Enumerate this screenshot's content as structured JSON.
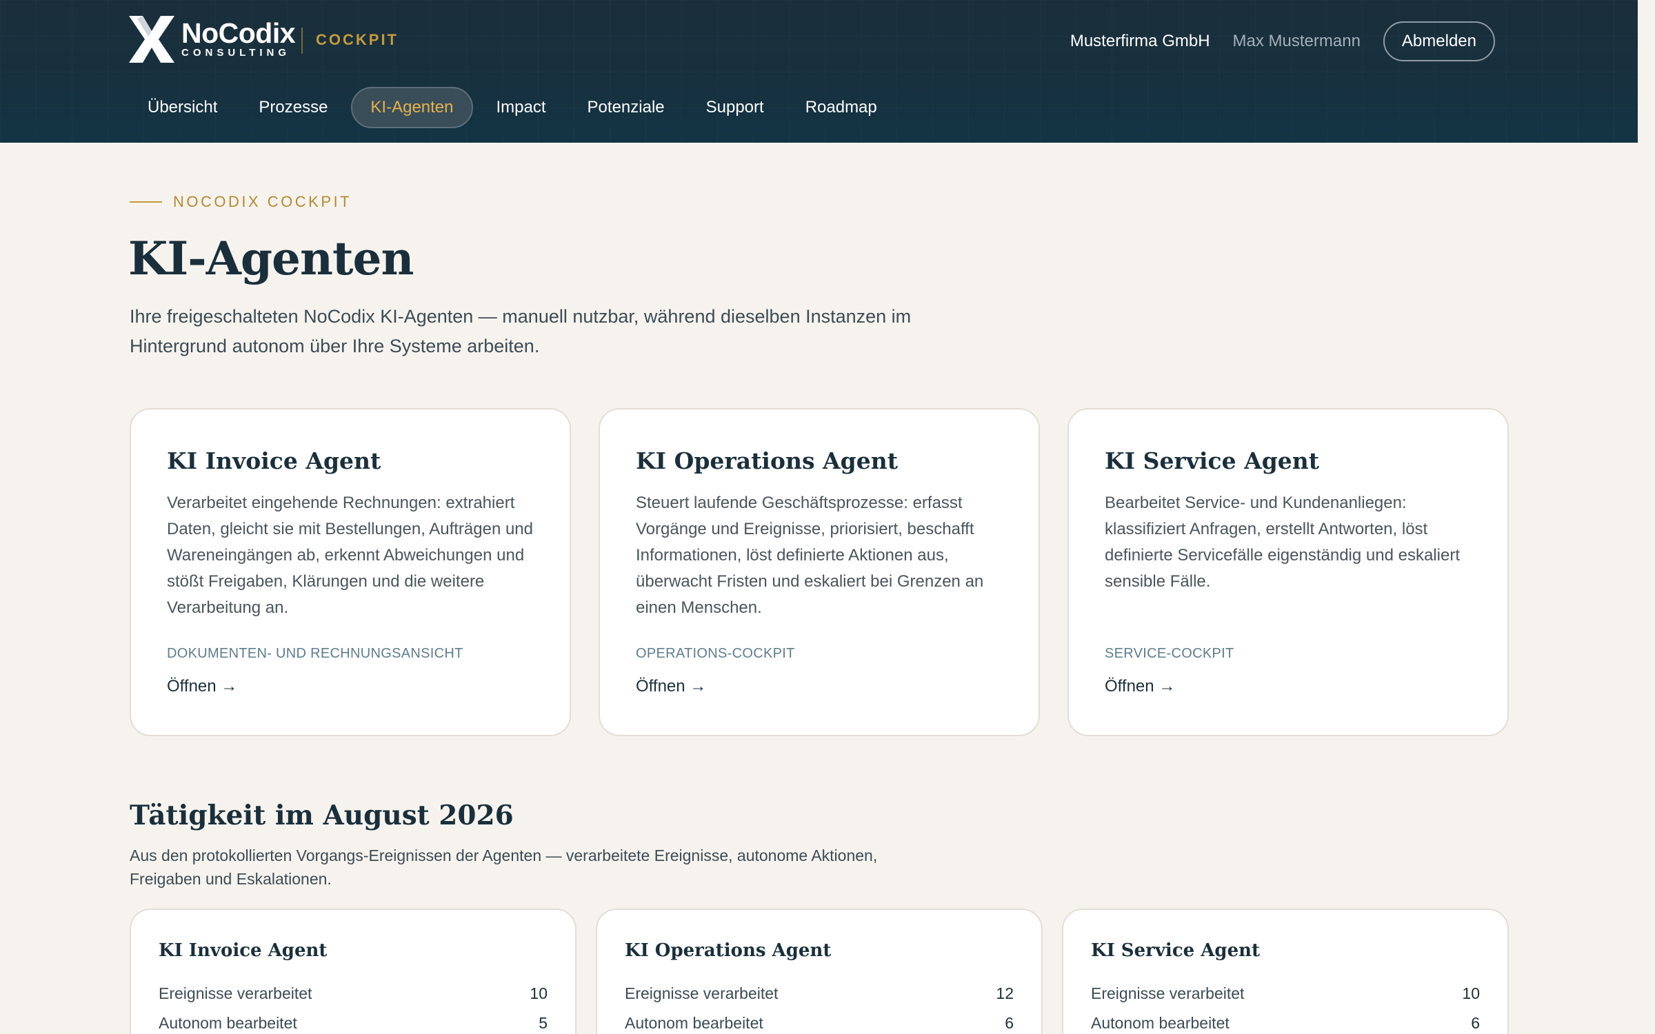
{
  "brand": {
    "name": "NoCodix",
    "sub": "CONSULTING",
    "product": "COCKPIT",
    "logo_icon": "x-logo-icon"
  },
  "header": {
    "company": "Musterfirma GmbH",
    "user": "Max Mustermann",
    "logout_label": "Abmelden"
  },
  "nav": {
    "items": [
      {
        "label": "Übersicht"
      },
      {
        "label": "Prozesse"
      },
      {
        "label": "KI-Agenten",
        "active": true
      },
      {
        "label": "Impact"
      },
      {
        "label": "Potenziale"
      },
      {
        "label": "Support"
      },
      {
        "label": "Roadmap"
      }
    ]
  },
  "main": {
    "eyebrow": "NOCODIX COCKPIT",
    "title": "KI-Agenten",
    "intro": "Ihre freigeschalteten NoCodix KI-Agenten — manuell nutzbar, während dieselben Instanzen im Hintergrund autonom über Ihre Systeme arbeiten.",
    "agents": [
      {
        "title": "KI Invoice Agent",
        "description": "Verarbeitet eingehende Rechnungen: extrahiert Daten, gleicht sie mit Bestellungen, Aufträgen und Wareneingängen ab, erkennt Abweichungen und stößt Freigaben, Klärungen und die weitere Verarbeitung an.",
        "tag": "DOKUMENTEN- UND RECHNUNGSANSICHT",
        "open_label": "Öffnen →"
      },
      {
        "title": "KI Operations Agent",
        "description": "Steuert laufende Geschäftsprozesse: erfasst Vorgänge und Ereignisse, priorisiert, beschafft Informationen, löst definierte Aktionen aus, überwacht Fristen und eskaliert bei Grenzen an einen Menschen.",
        "tag": "OPERATIONS-COCKPIT",
        "open_label": "Öffnen →"
      },
      {
        "title": "KI Service Agent",
        "description": "Bearbeitet Service- und Kundenanliegen: klassifiziert Anfragen, erstellt Antworten, löst definierte Servicefälle eigenständig und eskaliert sensible Fälle.",
        "tag": "SERVICE-COCKPIT",
        "open_label": "Öffnen →"
      }
    ]
  },
  "activity": {
    "title": "Tätigkeit im August 2026",
    "subtitle": "Aus den protokollierten Vorgangs-Ereignissen der Agenten — verarbeitete Ereignisse, autonome Aktionen, Freigaben und Eskalationen.",
    "cards": [
      {
        "title": "KI Invoice Agent",
        "rows": [
          {
            "label": "Ereignisse verarbeitet",
            "value": "10"
          },
          {
            "label": "Autonom bearbeitet",
            "value": "5"
          }
        ]
      },
      {
        "title": "KI Operations Agent",
        "rows": [
          {
            "label": "Ereignisse verarbeitet",
            "value": "12"
          },
          {
            "label": "Autonom bearbeitet",
            "value": "6"
          }
        ]
      },
      {
        "title": "KI Service Agent",
        "rows": [
          {
            "label": "Ereignisse verarbeitet",
            "value": "10"
          },
          {
            "label": "Autonom bearbeitet",
            "value": "6"
          }
        ]
      }
    ]
  },
  "colors": {
    "header_bg": "#17313f",
    "accent_gold": "#c69a3a",
    "page_bg": "#f6f3ee",
    "card_bg": "#ffffff",
    "heading": "#1a2f3b"
  }
}
